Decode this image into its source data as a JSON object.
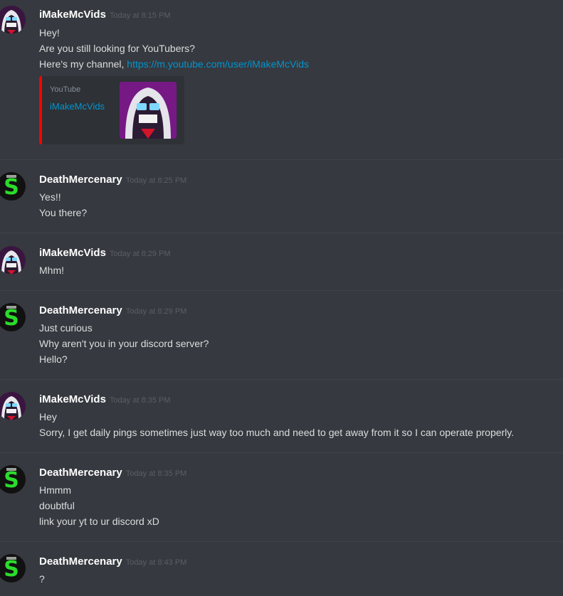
{
  "colors": {
    "background": "#36393f",
    "username": "#ffffff",
    "timestamp": "#5b5e63",
    "message_text": "#dcddde",
    "link": "#0096cf",
    "embed_accent": "#ff0000"
  },
  "messages": [
    {
      "author": "iMakeMcVids",
      "timestamp": "Today at 8:15 PM",
      "avatar_icon": "hooded-robot-avatar-icon",
      "lines": [
        "Hey!",
        "Are you still looking for YouTubers?"
      ],
      "link_line": {
        "prefix": "Here's my channel, ",
        "url": "https://m.youtube.com/user/iMakeMcVids"
      },
      "embed": {
        "provider": "YouTube",
        "title": "iMakeMcVids",
        "thumbnail_icon": "channel-thumbnail-icon"
      }
    },
    {
      "author": "DeathMercenary",
      "timestamp": "Today at 8:25 PM",
      "avatar_icon": "green-s-avatar-icon",
      "lines": [
        "Yes!!",
        "You there?"
      ]
    },
    {
      "author": "iMakeMcVids",
      "timestamp": "Today at 8:29 PM",
      "avatar_icon": "hooded-robot-avatar-icon",
      "lines": [
        "Mhm!"
      ]
    },
    {
      "author": "DeathMercenary",
      "timestamp": "Today at 8:29 PM",
      "avatar_icon": "green-s-avatar-icon",
      "lines": [
        "Just curious",
        "Why aren't you in your discord server?",
        "Hello?"
      ]
    },
    {
      "author": "iMakeMcVids",
      "timestamp": "Today at 8:35 PM",
      "avatar_icon": "hooded-robot-avatar-icon",
      "lines": [
        "Hey",
        "Sorry, I get daily pings sometimes just way too much and need to get away from it so I can operate properly."
      ]
    },
    {
      "author": "DeathMercenary",
      "timestamp": "Today at 8:35 PM",
      "avatar_icon": "green-s-avatar-icon",
      "lines": [
        "Hmmm",
        "doubtful",
        "link your yt to ur discord xD"
      ]
    },
    {
      "author": "DeathMercenary",
      "timestamp": "Today at 8:43 PM",
      "avatar_icon": "green-s-avatar-icon",
      "lines": [
        "?"
      ]
    }
  ]
}
